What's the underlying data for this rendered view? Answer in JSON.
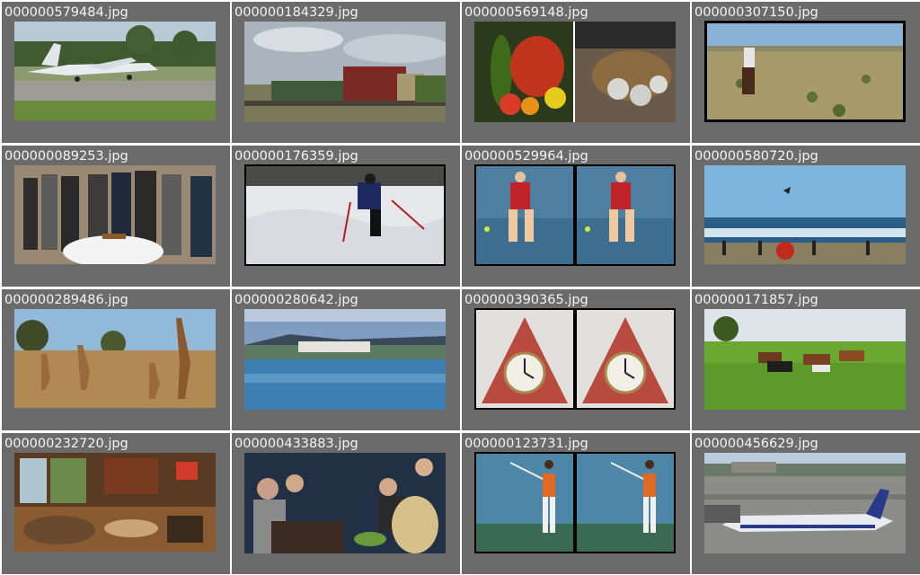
{
  "gallery": {
    "items": [
      {
        "filename": "000000579484.jpg",
        "subject": "fighter jet on runway"
      },
      {
        "filename": "000000184329.jpg",
        "subject": "freight train"
      },
      {
        "filename": "000000569148.jpg",
        "subject": "vegetables and cooking"
      },
      {
        "filename": "000000307150.jpg",
        "subject": "horse rider in desert"
      },
      {
        "filename": "000000089253.jpg",
        "subject": "men around cake"
      },
      {
        "filename": "000000176359.jpg",
        "subject": "skier on slope"
      },
      {
        "filename": "000000529964.jpg",
        "subject": "tennis player pair"
      },
      {
        "filename": "000000580720.jpg",
        "subject": "beach with kite"
      },
      {
        "filename": "000000289486.jpg",
        "subject": "giraffes in savanna"
      },
      {
        "filename": "000000280642.jpg",
        "subject": "resort pool"
      },
      {
        "filename": "000000390365.jpg",
        "subject": "triangle clock pair"
      },
      {
        "filename": "000000171857.jpg",
        "subject": "cows in field"
      },
      {
        "filename": "000000232720.jpg",
        "subject": "living room interior"
      },
      {
        "filename": "000000433883.jpg",
        "subject": "people at dinner"
      },
      {
        "filename": "000000123731.jpg",
        "subject": "tennis serve pair"
      },
      {
        "filename": "000000456629.jpg",
        "subject": "regional jet at airport"
      }
    ]
  }
}
